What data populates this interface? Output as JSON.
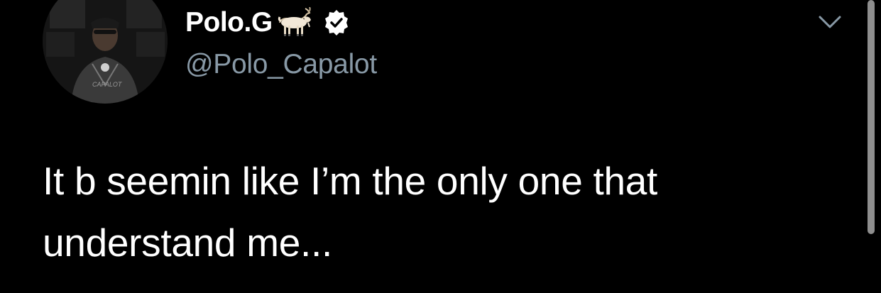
{
  "author": {
    "display_name": "Polo.G",
    "handle": "@Polo_Capalot",
    "verified": true,
    "name_emoji": "goat-icon",
    "avatar_text": "CAPALOT"
  },
  "tweet": {
    "text": "It b seemin like I’m the only one that understand me..."
  },
  "colors": {
    "background": "#000000",
    "primary_text": "#ffffff",
    "secondary_text": "#8899a6",
    "scrollbar": "#8e8e8e"
  }
}
